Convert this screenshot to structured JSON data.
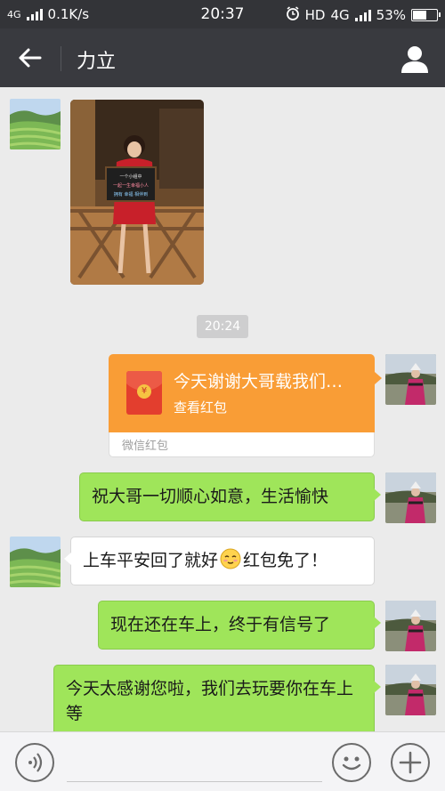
{
  "status_bar": {
    "network_label": "4G",
    "speed": "0.1K/s",
    "time": "20:37",
    "hd_label": "HD",
    "net_label_right": "4G",
    "battery": "53%",
    "battery_level": 0.53
  },
  "header": {
    "title": "力立"
  },
  "chat": {
    "photo_sign_lines": [
      "一个小组中",
      "一起一生幸福小人",
      "拥有 幸福 相伴到"
    ],
    "timestamp": "20:24",
    "hongbao": {
      "title": "今天谢谢大哥载我们…",
      "subtitle": "查看红包",
      "footer": "微信红包",
      "coin_glyph": "¥"
    },
    "messages": [
      {
        "side": "right",
        "text": "祝大哥一切顺心如意，生活愉快"
      },
      {
        "side": "left",
        "text_before": "上车平安回了就好",
        "emoji": "blush-emoji",
        "text_after": "红包免了！"
      },
      {
        "side": "right",
        "text": "现在还在车上，终于有信号了"
      },
      {
        "side": "right",
        "text": "今天太感谢您啦，我们去玩要你在车上等"
      }
    ]
  },
  "input": {
    "placeholder": ""
  },
  "colors": {
    "status_bar": "#333438",
    "nav_bar": "#393a3f",
    "chat_bg": "#ebebeb",
    "bubble_green": "#9fe55a",
    "hongbao_orange": "#f99d36"
  }
}
